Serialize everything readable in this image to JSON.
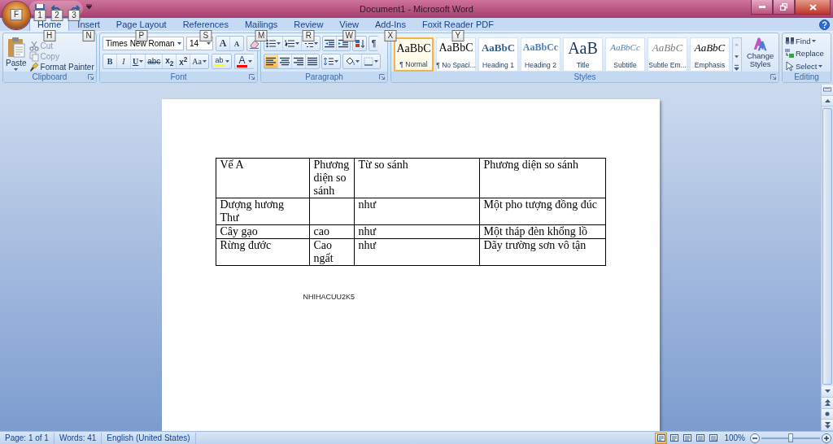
{
  "window": {
    "title": "Document1 - Microsoft Word"
  },
  "office_button": {
    "keytip": "F"
  },
  "quick_access": {
    "keytips": [
      "1",
      "2",
      "3"
    ]
  },
  "tabs": [
    {
      "label": "Home",
      "keytip": "H",
      "selected": true
    },
    {
      "label": "Insert",
      "keytip": "N",
      "selected": false
    },
    {
      "label": "Page Layout",
      "keytip": "P",
      "selected": false
    },
    {
      "label": "References",
      "keytip": "S",
      "selected": false
    },
    {
      "label": "Mailings",
      "keytip": "M",
      "selected": false
    },
    {
      "label": "Review",
      "keytip": "R",
      "selected": false
    },
    {
      "label": "View",
      "keytip": "W",
      "selected": false
    },
    {
      "label": "Add-Ins",
      "keytip": "X",
      "selected": false
    },
    {
      "label": "Foxit Reader PDF",
      "keytip": "Y",
      "selected": false
    }
  ],
  "clipboard": {
    "label": "Clipboard",
    "paste": "Paste",
    "items": [
      {
        "label": "Cut",
        "kind": "cut",
        "disabled": true
      },
      {
        "label": "Copy",
        "kind": "copy",
        "disabled": true
      },
      {
        "label": "Format Painter",
        "kind": "painter",
        "disabled": false
      }
    ]
  },
  "font": {
    "label": "Font",
    "font_name": "Times New Roman",
    "font_size": "14",
    "grow": "A",
    "shrink": "A",
    "format_buttons": [
      {
        "label": "B",
        "kind": "bold"
      },
      {
        "label": "I",
        "kind": "italic"
      },
      {
        "label": "U",
        "kind": "underline"
      },
      {
        "label": "abc",
        "kind": "strike"
      },
      {
        "label": "x$_{2}$",
        "kind": "sub"
      },
      {
        "label": "x$^{2}$",
        "kind": "sup"
      },
      {
        "label": "Aa",
        "kind": "case"
      }
    ],
    "highlight": "ab",
    "font_color": "A"
  },
  "paragraph": {
    "label": "Paragraph",
    "show_marks": "¶",
    "alignments": [
      {
        "kind": "left",
        "selected": true
      },
      {
        "kind": "center",
        "selected": false
      },
      {
        "kind": "right",
        "selected": false
      },
      {
        "kind": "justify",
        "selected": false
      }
    ]
  },
  "styles": {
    "label": "Styles",
    "change_styles": "Change Styles",
    "gallery": [
      {
        "preview": "AaBbC",
        "name": "¶ Normal",
        "kind": "normal",
        "selected": true
      },
      {
        "preview": "AaBbC",
        "name": "¶ No Spaci...",
        "kind": "normal",
        "selected": false
      },
      {
        "preview": "AaBbC",
        "name": "Heading 1",
        "kind": "heading1",
        "selected": false
      },
      {
        "preview": "AaBbCc",
        "name": "Heading 2",
        "kind": "heading2",
        "selected": false
      },
      {
        "preview": "AaB",
        "name": "Title",
        "kind": "title",
        "selected": false
      },
      {
        "preview": "AaBbCc",
        "name": "Subtitle",
        "kind": "subtitle",
        "selected": false
      },
      {
        "preview": "AaBbC",
        "name": "Subtle Em...",
        "kind": "subtle",
        "selected": false
      },
      {
        "preview": "AaBbC",
        "name": "Emphasis",
        "kind": "emphasis",
        "selected": false
      }
    ]
  },
  "editing": {
    "label": "Editing",
    "items": [
      {
        "label": "Find",
        "kind": "find"
      },
      {
        "label": "Replace",
        "kind": "replace"
      },
      {
        "label": "Select",
        "kind": "select"
      }
    ]
  },
  "document": {
    "table": {
      "rows": [
        [
          "Vế A",
          "Phương diện so sánh",
          "Từ so sánh",
          "Phương diện so sánh"
        ],
        [
          "Dượng hương Thư",
          null,
          "như",
          "Một pho tượng đồng đúc"
        ],
        [
          "Cây gạo",
          "cao",
          "như",
          "Một tháp đèn khổng lồ"
        ],
        [
          "Rừng đước",
          "Cao ngất",
          "như",
          "Dãy trường sơn vô tận"
        ]
      ]
    },
    "text": "NHIHACUU2K5"
  },
  "status_bar": {
    "page": "Page: 1 of 1",
    "words": "Words: 41",
    "language": "English (United States)",
    "views": [
      {
        "selected": true
      },
      {
        "selected": false
      },
      {
        "selected": false
      },
      {
        "selected": false
      },
      {
        "selected": false
      }
    ],
    "zoom": "100%",
    "zoom_slider": {
      "level": 0.5
    }
  }
}
